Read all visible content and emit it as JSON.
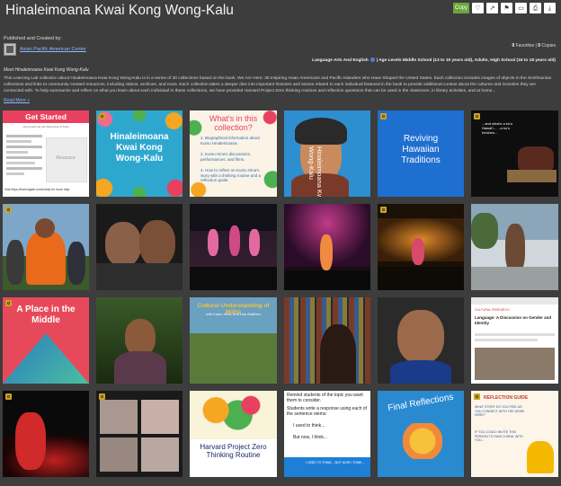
{
  "header": {
    "title": "Hinaleimoana Kwai Kong Wong-Kalu",
    "copy_label": "Copy",
    "action_icons": [
      "heart-icon",
      "share-icon",
      "flag-icon",
      "embed-icon",
      "print-icon",
      "download-icon"
    ]
  },
  "publisher": {
    "label": "Published and Created by:",
    "name": "Asian Pacific American Center"
  },
  "stats": {
    "favorites_count": "0",
    "favorites_label": "Favorites",
    "copies_count": "0",
    "copies_label": "Copies"
  },
  "subjects": {
    "subject": "Language Arts And English",
    "levels": "Age Levels Middle School (13 to 15 years old), Adults, High School (16 to 18 years old)"
  },
  "intro": "Meet Hinaleimoana Kwai Kong Wong-Kalu",
  "description": "This Learning Lab collection about Hinaleimoana Kwai Kong Wong-Kalu is in a series of 30 collections based on the book, We Are Here: 30 Inspiring Asian Americans and Pacific Islanders who Have Shaped the United States. Each collection includes images of objects in the Smithsonian collections and links to community-created resources, including videos, archives, and more. Each collection takes a deeper dive into important histories and stories related to each individual featured in the book to provide additional context about the cultures and societies they are connected with. To help summarize and reflect on what you learn about each individual in these collections, we have provided Harvard Project Zero thinking routines and reflection questions that can be used in the classroom, in library activities, and at home...",
  "read_more": "Read More »",
  "tiles": [
    {
      "title": "Get Started",
      "subtitle": "using Learning Lab Resources & Tools",
      "watermark": "Resource",
      "footer": "Visit https://learninglab.si.edu/help for more help"
    },
    {
      "title": "Hinaleimoana Kwai Kong Wong-Kalu"
    },
    {
      "title": "What's in this collection?",
      "items": [
        "1. Biographical information about Kumu Hinaleimoana.",
        "2. Kumu Hina's discussions, performances, and films.",
        "3. How to reflect on Kumu Hina's story with a thinking routine and a reflection guide"
      ]
    },
    {
      "title": "Hinaleimoana Kwai Kong Wong-Kalu"
    },
    {
      "title": "Reviving Hawaiian Traditions"
    },
    {
      "title": "...and what's a ku'u Hawai'i... ...a ku'u ha'aheo..."
    },
    {
      "title": ""
    },
    {
      "title": ""
    },
    {
      "title": ""
    },
    {
      "title": ""
    },
    {
      "title": ""
    },
    {
      "title": ""
    },
    {
      "title": "A Place in the Middle"
    },
    {
      "title": ""
    },
    {
      "title": "Cultural Understanding of Māhū",
      "subtitle": "with Kumu Hina, and Lisa Nakihiro"
    },
    {
      "title": ""
    },
    {
      "title": ""
    },
    {
      "title": "Language: A Discussion on Gender and Identity",
      "header": "CULTURAL RESEARCH"
    },
    {
      "title": ""
    },
    {
      "title": ""
    },
    {
      "title": "Harvard Project Zero Thinking Routine"
    },
    {
      "title": "Remind students of the topic you want them to consider.",
      "lines": [
        "Students write a response using each of the sentence stems:",
        "I used to think...",
        "But now, I think..."
      ],
      "footer": "I USED TO THINK... BUT NOW I THINK..."
    },
    {
      "title": "Final Reflections"
    },
    {
      "title": "REFLECTION GUIDE",
      "lines": [
        "WHAT STORY DO YOU FEEL AS YOU CONNECT WITH THE WORK HERE?",
        "IF YOU COULD INVITE THIS PERSON TO HAVE A MEAL WITH YOU..."
      ]
    }
  ],
  "colors": {
    "background": "#3d3d3d",
    "copy_button": "#6aa73a",
    "link": "#8fb8ff",
    "clip_badge": "#c9a227"
  }
}
